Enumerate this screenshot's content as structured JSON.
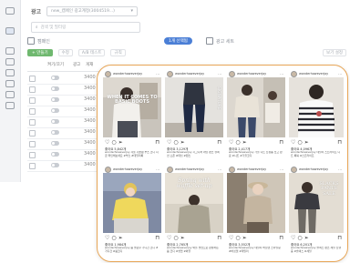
{
  "app": {
    "account_label": "광고",
    "account_value": "new_캠페인 광고계정(3004519...)",
    "search_placeholder": "검색 및 필터링",
    "campaign_tab": "캠페인",
    "adset_pill": "1개 선택됨",
    "ads_tab": "광고 세트",
    "create_label": "+ 만들기",
    "toolbar_items": [
      "수정",
      "A/B 테스트",
      "규칙",
      "보기 설정"
    ],
    "columns": [
      "켜기/끄기",
      "광고",
      "게재"
    ],
    "row_numbers": [
      "3400",
      "3400",
      "3400",
      "3400",
      "3400",
      "3400",
      "3400",
      "3400",
      "3400"
    ]
  },
  "feed": {
    "posts": [
      {
        "username": "wonderhoweverjoy",
        "overlay": "WHEN IT COMES TO BASIC BOOTS",
        "likes": "좋아요 5,842개",
        "caption": "wonderhoweverjoy 겨울 기본템 부츠 코디 지금 확인해보세요 #부츠 #데일리룩"
      },
      {
        "username": "wonderhoweverjoy",
        "overlay": "SIGNATURE",
        "likes": "좋아요 3,129개",
        "caption": "wonderhoweverjoy 시그니처 데님 팬츠 컬렉션 오픈 #데님 #팬츠"
      },
      {
        "username": "wonderhoweverjoy",
        "overlay": "",
        "likes": "좋아요 2,417개",
        "caption": "wonderhoweverjoy 가을 니트 신상품 입고 완료 #니트 #가을코디"
      },
      {
        "username": "wonderhoweverjoy",
        "overlay": "",
        "likes": "좋아요 4,096개",
        "caption": "wonderhoweverjoy 데일리 스트라이프 니트 룩북 #스트라이프"
      },
      {
        "username": "wonderhoweverjoy",
        "overlay": "",
        "likes": "좋아요 1,984개",
        "caption": "wonderhoweverjoy 봄 옐로우 가디건 코디 #가디건 #봄코디"
      },
      {
        "username": "wonderhoweverjoy",
        "overlay": "Spring with waffle set-up",
        "likes": "좋아요 2,765개",
        "caption": "wonderhoweverjoy 와플 셋업으로 완성하는 봄 코디 #셋업 #와플"
      },
      {
        "username": "wonderhoweverjoy",
        "overlay": "",
        "likes": "좋아요 3,552개",
        "caption": "wonderhoweverjoy 데일리 버킷햇 스타일링 #버킷햇 #데일리"
      },
      {
        "username": "wonderhoweverjoy",
        "overlay": "SLACKS PANTS SALE",
        "likes": "좋아요 6,201개",
        "caption": "wonderhoweverjoy 슬랙스 팬츠 세일 진행중 #슬랙스 #세일"
      }
    ]
  },
  "icons": {
    "like": "heart-icon",
    "comment": "comment-icon",
    "share": "send-icon",
    "save": "bookmark-icon",
    "more": "more-dots-icon"
  },
  "colors": {
    "highlight_border": "#e8a657",
    "adset_pill": "#4b7fd6",
    "create_button": "#6fb86f"
  }
}
